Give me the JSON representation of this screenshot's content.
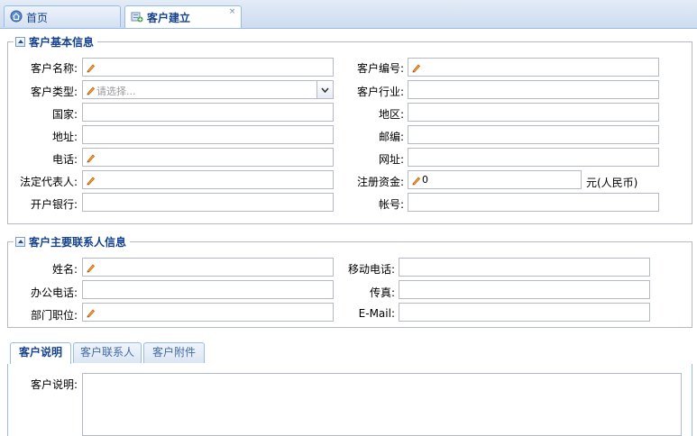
{
  "top_tabs": [
    {
      "label": "首页",
      "icon": "home-icon"
    },
    {
      "label": "客户建立",
      "icon": "add-customer-icon",
      "close": "×"
    }
  ],
  "basic_info": {
    "title": "客户基本信息",
    "fields": {
      "name": {
        "label": "客户名称:",
        "value": ""
      },
      "code": {
        "label": "客户编号:",
        "value": ""
      },
      "type": {
        "label": "客户类型:",
        "placeholder": "请选择..."
      },
      "industry": {
        "label": "客户行业:",
        "value": ""
      },
      "country": {
        "label": "国家:",
        "value": ""
      },
      "region": {
        "label": "地区:",
        "value": ""
      },
      "address": {
        "label": "地址:",
        "value": ""
      },
      "postcode": {
        "label": "邮编:",
        "value": ""
      },
      "phone": {
        "label": "电话:",
        "value": ""
      },
      "website": {
        "label": "网址:",
        "value": ""
      },
      "legal_rep": {
        "label": "法定代表人:",
        "value": ""
      },
      "capital": {
        "label": "注册资金:",
        "value": "0",
        "unit": "元(人民币)"
      },
      "bank": {
        "label": "开户银行:",
        "value": ""
      },
      "account": {
        "label": "帐号:",
        "value": ""
      }
    }
  },
  "contact_info": {
    "title": "客户主要联系人信息",
    "fields": {
      "name": {
        "label": "姓名:",
        "value": ""
      },
      "mobile": {
        "label": "移动电话:",
        "value": ""
      },
      "office_phone": {
        "label": "办公电话:",
        "value": ""
      },
      "fax": {
        "label": "传真:",
        "value": ""
      },
      "position": {
        "label": "部门职位:",
        "value": ""
      },
      "email": {
        "label": "E-Mail:",
        "value": ""
      }
    }
  },
  "bottom_tabs": [
    "客户说明",
    "客户联系人",
    "客户附件"
  ],
  "description": {
    "label": "客户说明:",
    "value": ""
  },
  "colors": {
    "accent": "#15428b",
    "border": "#99bbe8",
    "required": "#e07a12"
  }
}
